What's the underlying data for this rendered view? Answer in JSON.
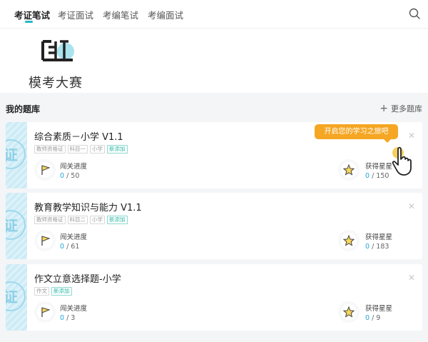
{
  "tabs": [
    {
      "label": "考证笔试",
      "active": true
    },
    {
      "label": "考证面试",
      "active": false
    },
    {
      "label": "考编笔试",
      "active": false
    },
    {
      "label": "考编面试",
      "active": false
    }
  ],
  "hero": {
    "label": "模考大赛"
  },
  "section": {
    "title": "我的题库",
    "more": "更多题库"
  },
  "tooltip": "开启您的学习之旅吧",
  "colors": {
    "accent": "#25b6c6",
    "progress": "#25a5d8",
    "tooltip": "#f5a623",
    "new_tag": "#2fb8a8"
  },
  "cards": [
    {
      "title": "综合素质－小学 V1.1",
      "tags": [
        {
          "text": "教师资格证"
        },
        {
          "text": "科目一"
        },
        {
          "text": "小学"
        },
        {
          "text": "新添加",
          "new": true
        }
      ],
      "progress_label": "闯关进度",
      "progress_current": "0",
      "progress_total": "50",
      "stars_label": "获得星星",
      "stars_current": "0",
      "stars_total": "150",
      "stamp": "证"
    },
    {
      "title": "教育教学知识与能力 V1.1",
      "tags": [
        {
          "text": "教师资格证"
        },
        {
          "text": "科目二"
        },
        {
          "text": "小学"
        },
        {
          "text": "新添加",
          "new": true
        }
      ],
      "progress_label": "闯关进度",
      "progress_current": "0",
      "progress_total": "61",
      "stars_label": "获得星星",
      "stars_current": "0",
      "stars_total": "183",
      "stamp": "证"
    },
    {
      "title": "作文立意选择题-小学",
      "tags": [
        {
          "text": "作文"
        },
        {
          "text": "新添加",
          "new": true
        }
      ],
      "progress_label": "闯关进度",
      "progress_current": "0",
      "progress_total": "3",
      "stars_label": "获得星星",
      "stars_current": "0",
      "stars_total": "9",
      "stamp": "证"
    }
  ]
}
